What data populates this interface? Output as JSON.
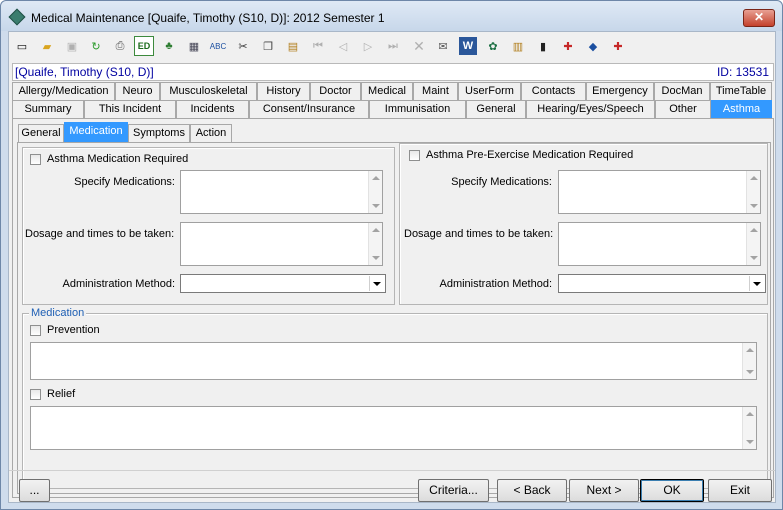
{
  "window": {
    "title": "Medical Maintenance   [Quaife, Timothy (S10, D)]: 2012 Semester 1",
    "close_label": "✕"
  },
  "toolbar": {
    "icons": [
      "new-document-icon",
      "open-folder-icon",
      "save-icon",
      "refresh-icon",
      "print-icon",
      "edit-icon",
      "tree-icon",
      "calculator-icon",
      "spellcheck-icon",
      "cut-icon",
      "copy-icon",
      "paste-icon",
      "first-record-icon",
      "previous-record-icon",
      "next-record-icon",
      "last-record-icon",
      "delete-icon",
      "email-icon",
      "word-icon",
      "excel-icon",
      "clipboard-icon",
      "barcode-icon",
      "medical-kit-icon",
      "tag-icon",
      "add-note-icon"
    ],
    "edit_label": "ED"
  },
  "patient": {
    "name": "[Quaife, Timothy (S10, D)]",
    "id_text": "ID: 13531"
  },
  "tabs_row1": [
    "Allergy/Medication",
    "Neuro",
    "Musculoskeletal",
    "History",
    "Doctor",
    "Medical",
    "Maint",
    "UserForm",
    "Contacts",
    "Emergency",
    "DocMan",
    "TimeTable"
  ],
  "tabs_row2": [
    "Summary",
    "This Incident",
    "Incidents",
    "Consent/Insurance",
    "Immunisation",
    "General",
    "Hearing/Eyes/Speech",
    "Other",
    "Asthma"
  ],
  "selected_tab": "Asthma",
  "subtabs": [
    "General",
    "Medication",
    "Symptoms",
    "Action"
  ],
  "selected_subtab": "Medication",
  "asthma_med": {
    "checkbox_label": "Asthma Medication Required",
    "specify_label": "Specify Medications:",
    "specify_value": "",
    "dosage_label": "Dosage and times to be taken:",
    "dosage_value": "",
    "admin_label": "Administration Method:",
    "admin_value": ""
  },
  "pre_exercise": {
    "checkbox_label": "Asthma Pre-Exercise Medication Required",
    "specify_label": "Specify Medications:",
    "specify_value": "",
    "dosage_label": "Dosage and times to be taken:",
    "dosage_value": "",
    "admin_label": "Administration Method:",
    "admin_value": ""
  },
  "medication_group": {
    "title": "Medication",
    "prevention_label": "Prevention",
    "prevention_value": "",
    "relief_label": "Relief",
    "relief_value": ""
  },
  "buttons": {
    "more": "...",
    "criteria": "Criteria...",
    "back": "< Back",
    "next": "Next >",
    "ok": "OK",
    "exit": "Exit"
  }
}
